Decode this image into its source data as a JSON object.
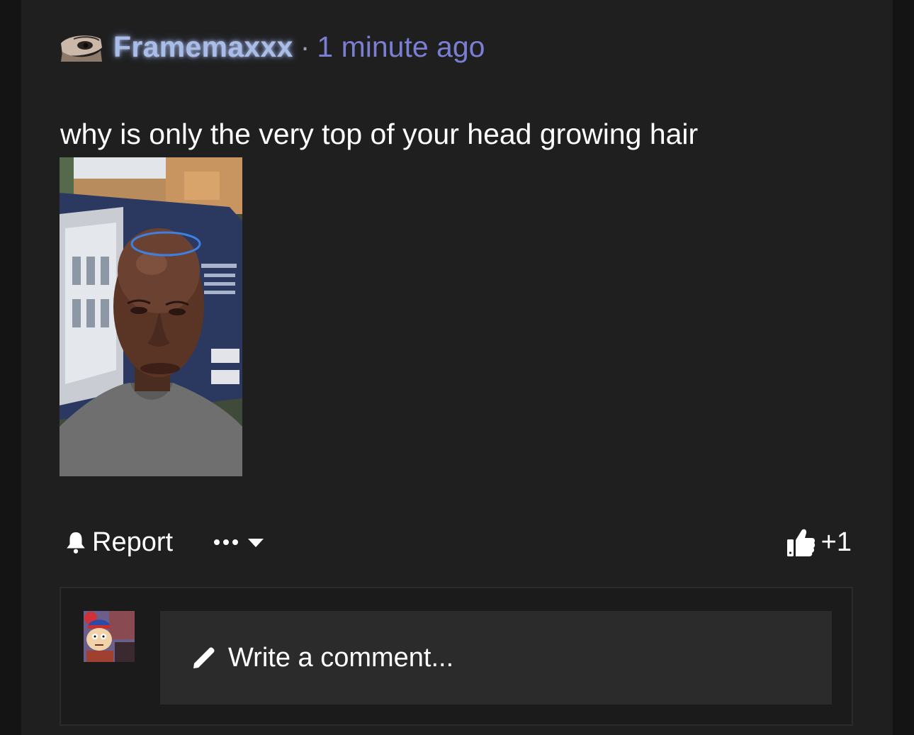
{
  "post": {
    "author": "Framemaxxx",
    "separator": "·",
    "timestamp": "1 minute ago",
    "text": "why is only the very top of your head growing hair",
    "image_icon": "selfie-photo"
  },
  "actions": {
    "report_label": "Report",
    "report_icon": "bell-icon",
    "more_icon": "ellipsis-dropdown-icon",
    "like_icon": "thumbs-up-icon",
    "like_count": "+1"
  },
  "comment": {
    "placeholder": "Write a comment...",
    "pencil_icon": "pencil-icon"
  },
  "colors": {
    "background": "#1f1f1f",
    "username": "#a9bde8",
    "timestamp": "#7b7fd4",
    "text": "#ffffff",
    "input_bg": "#2b2b2b"
  }
}
